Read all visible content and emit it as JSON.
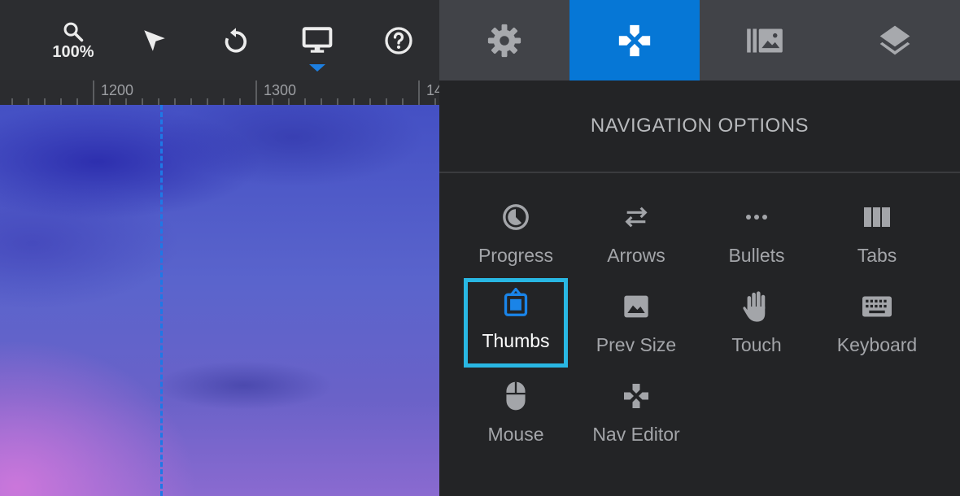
{
  "toolbar": {
    "zoom_label": "100%",
    "tools": [
      "zoom-icon",
      "select-pointer-icon",
      "undo-icon",
      "desktop-view-icon",
      "help-icon"
    ]
  },
  "ruler": {
    "labels": [
      "1200",
      "1300",
      "14"
    ]
  },
  "tabs": {
    "items": [
      "settings-gear-icon",
      "navigation-gamepad-icon",
      "slides-library-icon",
      "layers-icon"
    ],
    "active": "navigation-gamepad-icon"
  },
  "panel": {
    "title": "NAVIGATION OPTIONS",
    "options": [
      {
        "label": "Progress",
        "icon": "progress-pie-icon"
      },
      {
        "label": "Arrows",
        "icon": "arrows-icon"
      },
      {
        "label": "Bullets",
        "icon": "bullets-icon"
      },
      {
        "label": "Tabs",
        "icon": "tabs-icon"
      },
      {
        "label": "Thumbs",
        "icon": "thumbs-icon"
      },
      {
        "label": "Prev Size",
        "icon": "image-icon"
      },
      {
        "label": "Touch",
        "icon": "hand-icon"
      },
      {
        "label": "Keyboard",
        "icon": "keyboard-icon"
      },
      {
        "label": "Mouse",
        "icon": "mouse-icon"
      },
      {
        "label": "Nav Editor",
        "icon": "gamepad-icon"
      }
    ],
    "selected": "Thumbs"
  },
  "colors": {
    "accent": "#0677d6",
    "selection_outline": "#29b7e3",
    "guide": "#1f78e6"
  }
}
